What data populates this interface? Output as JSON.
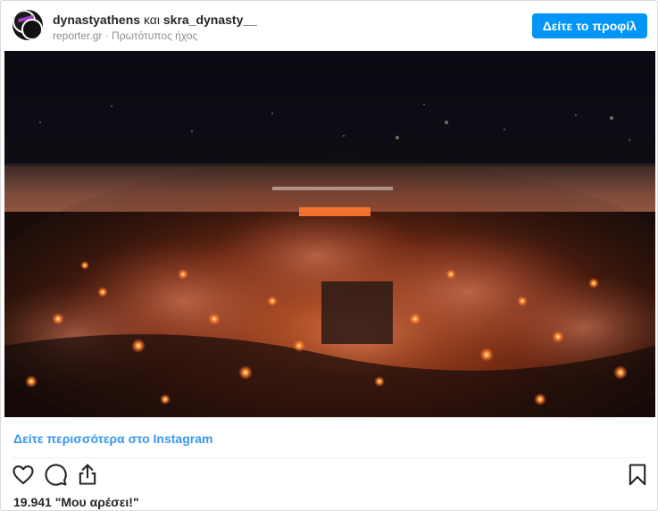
{
  "header": {
    "user_primary": "dynastyathens",
    "conjunction": "και",
    "user_secondary": "skra_dynasty__",
    "source": "reporter.gr",
    "separator": "·",
    "audio": "Πρωτότυπος ήχος",
    "profile_button_label": "Δείτε το προφίλ"
  },
  "media": {
    "description_icon": "photo"
  },
  "footer": {
    "more_link": "Δείτε περισσότερα στο Instagram",
    "likes": "19.941 \"Μου αρέσει!\""
  },
  "icons": {
    "like": "heart-icon",
    "comment": "comment-icon",
    "share": "share-icon",
    "save": "bookmark-icon"
  },
  "colors": {
    "accent": "#0095f6",
    "link": "#3897f0",
    "text": "#262626",
    "muted": "#8e8e8e",
    "border": "#dbdbdb"
  }
}
